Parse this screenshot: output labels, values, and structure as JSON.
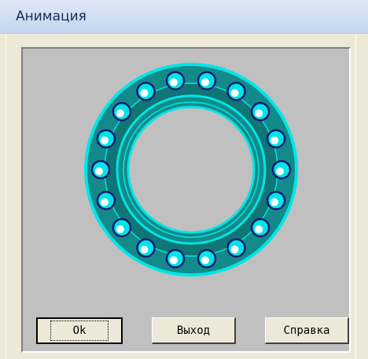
{
  "window": {
    "title": "Анимация"
  },
  "animation": {
    "subject": "ball-bearing",
    "ball_count": 18,
    "colors": {
      "panel_background": "#c0c0c0",
      "ring_fill": "#138a8a",
      "ring_outline": "#00e5e5",
      "ball_fill": "#00e5e5",
      "ball_highlight": "#ffffff",
      "ball_outline": "#1a1a70"
    }
  },
  "buttons": {
    "ok_label": "Ok",
    "exit_label": "Выход",
    "help_label": "Справка"
  }
}
